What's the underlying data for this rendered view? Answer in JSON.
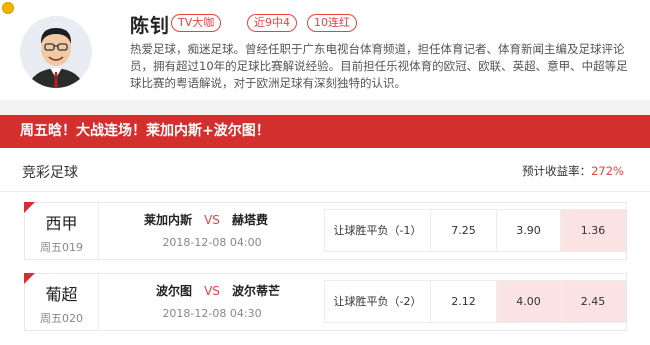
{
  "expert": {
    "name": "陈钊",
    "tags": [
      "TV大咖",
      "近9中4",
      "10连红"
    ],
    "bio": "热爱足球，痴迷足球。曾经任职于广东电视台体育频道，担任体育记者、体育新闻主编及足球评论员，拥有超过10年的足球比赛解说经验。目前担任乐视体育的欧冠、欧联、英超、意甲、中超等足球比赛的粤语解说，对于欧洲足球有深刻独特的认识。"
  },
  "article_title": "周五晗！大战连场！莱加内斯+波尔图！",
  "section": {
    "title": "竞彩足球",
    "yield_label": "预计收益率：",
    "yield_value": "272%"
  },
  "matches": [
    {
      "league": "西甲",
      "number": "周五019",
      "home": "莱加内斯",
      "vs": "VS",
      "away": "赫塔费",
      "time": "2018-12-08 04:00",
      "bet_type": "让球胜平负（-1）",
      "odds": [
        "7.25",
        "3.90",
        "1.36"
      ],
      "selected_index": 2
    },
    {
      "league": "葡超",
      "number": "周五020",
      "home": "波尔图",
      "vs": "VS",
      "away": "波尔蒂芒",
      "time": "2018-12-08 04:30",
      "bet_type": "让球胜平负（-2）",
      "odds": [
        "2.12",
        "4.00",
        "2.45"
      ],
      "selected_index": [
        1,
        2
      ]
    }
  ],
  "colors": {
    "accent": "#d42f2f",
    "tag": "#e64340",
    "highlight": "#fbe3e3"
  }
}
